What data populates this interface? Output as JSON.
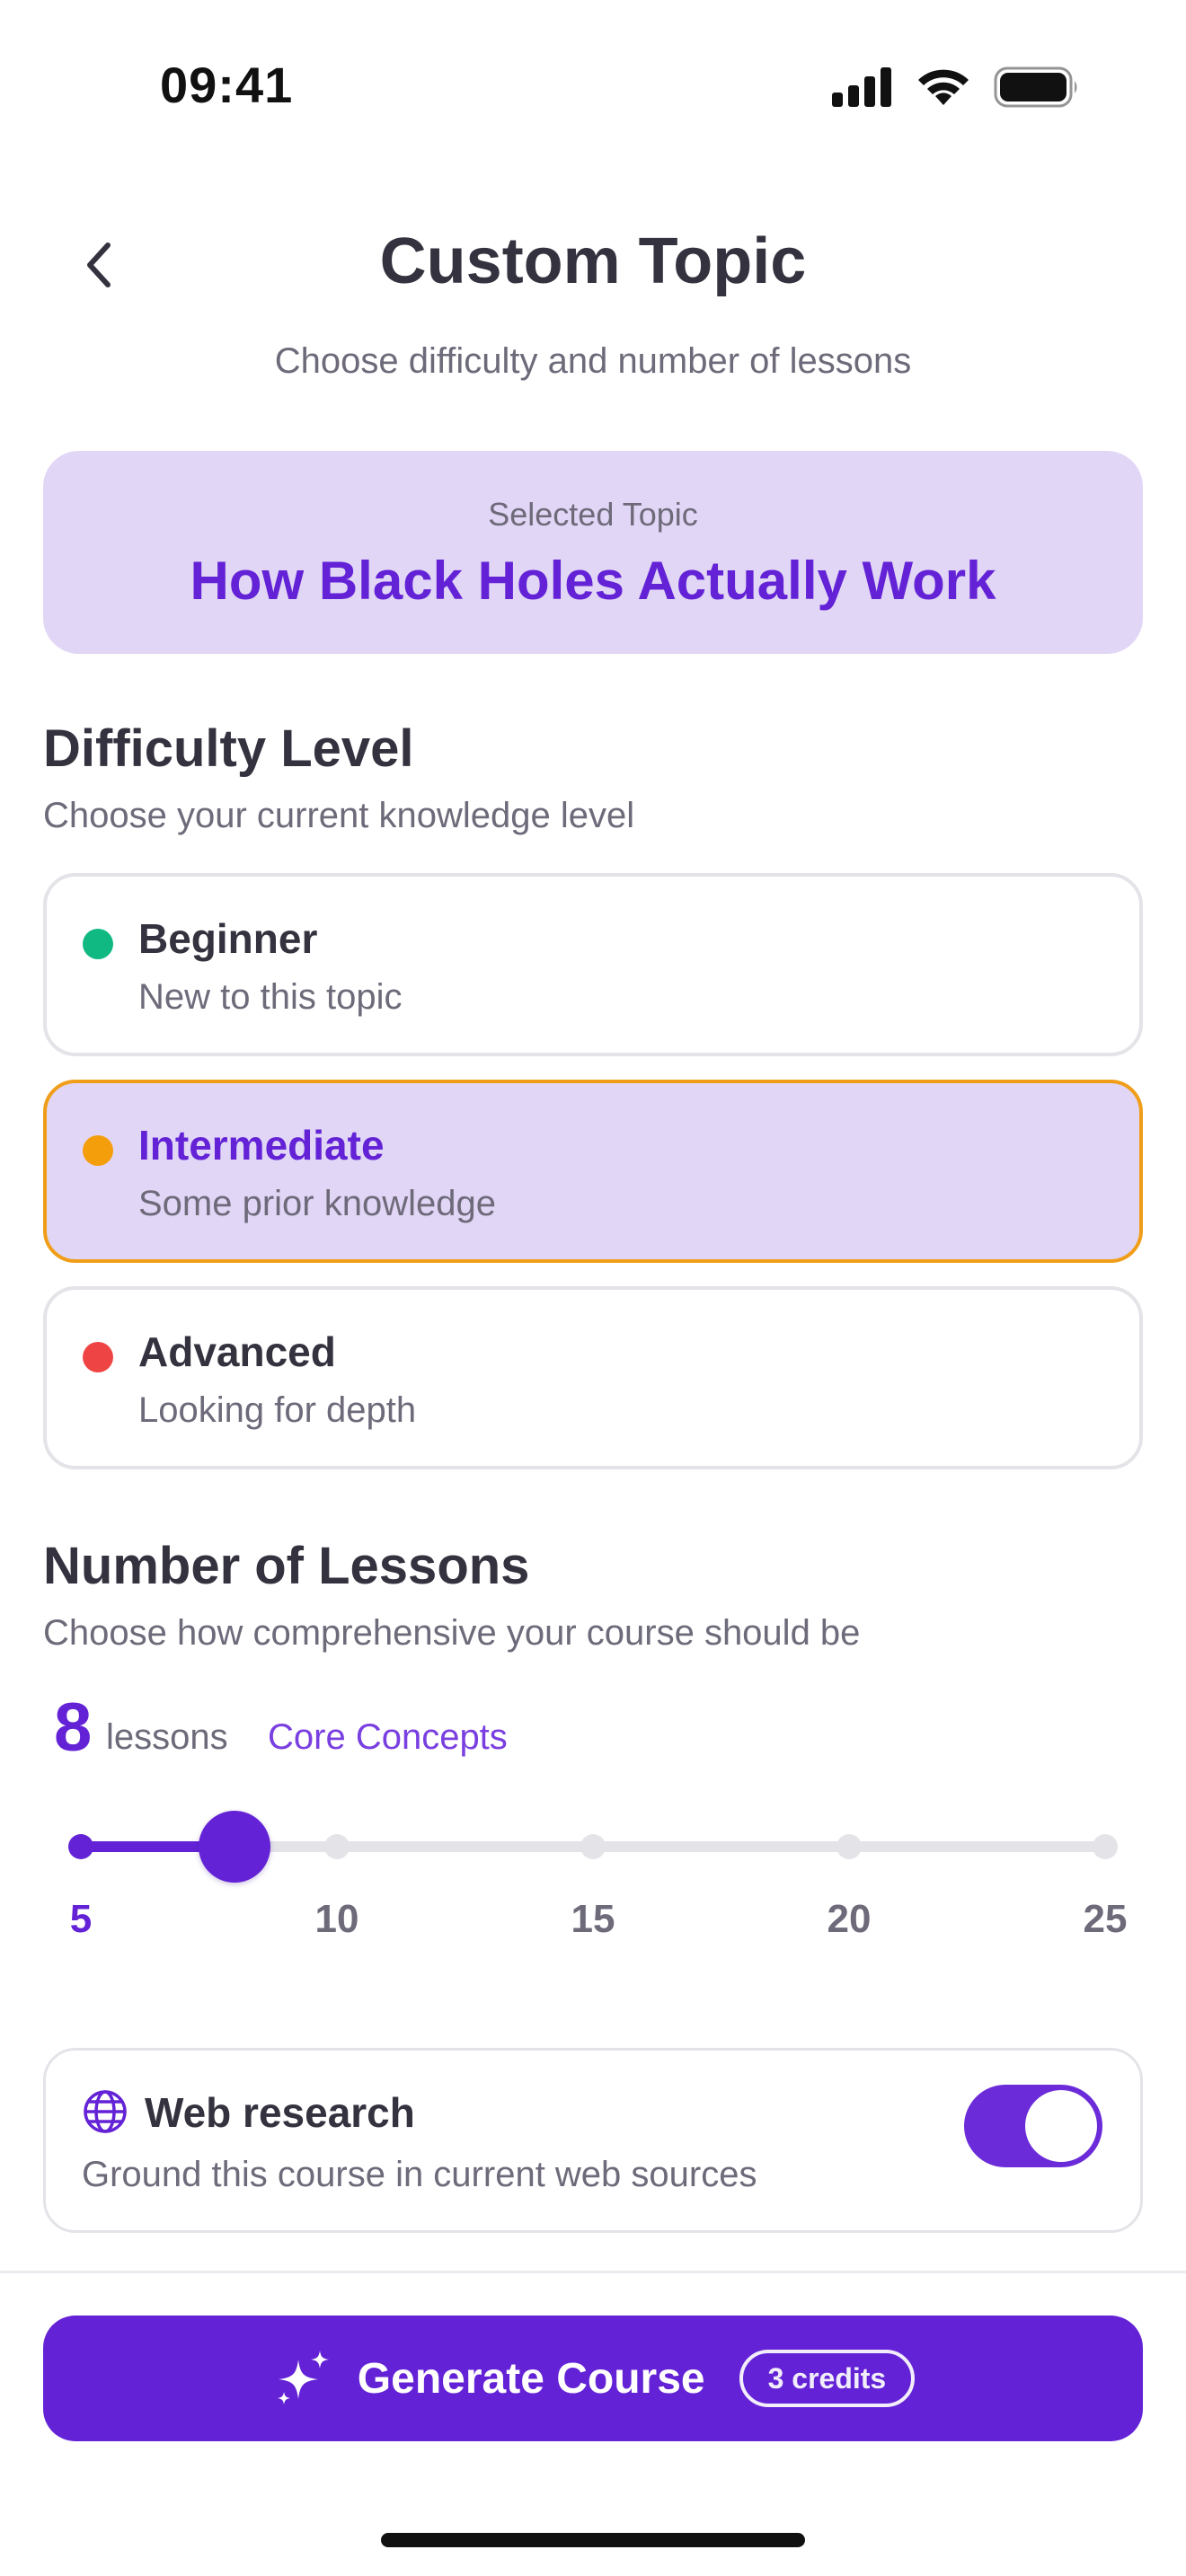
{
  "status_bar": {
    "time": "09:41"
  },
  "header": {
    "title": "Custom Topic",
    "subtitle": "Choose difficulty and number of lessons"
  },
  "topic": {
    "label": "Selected Topic",
    "name": "How Black Holes Actually Work"
  },
  "difficulty": {
    "title": "Difficulty Level",
    "description": "Choose your current knowledge level",
    "selected": "Intermediate",
    "options": [
      {
        "label": "Beginner",
        "description": "New to this topic",
        "color": "#10b981"
      },
      {
        "label": "Intermediate",
        "description": "Some prior knowledge",
        "color": "#f59e0b"
      },
      {
        "label": "Advanced",
        "description": "Looking for depth",
        "color": "#ef4444"
      }
    ]
  },
  "lessons": {
    "title": "Number of Lessons",
    "description": "Choose how comprehensive your course should be",
    "count": "8",
    "unit": "lessons",
    "tier": "Core Concepts",
    "value": 8,
    "min": 5,
    "max": 25,
    "ticks": [
      "5",
      "10",
      "15",
      "20",
      "25"
    ]
  },
  "web_research": {
    "title": "Web research",
    "description": "Ground this course in current web sources",
    "enabled": true
  },
  "generate": {
    "label": "Generate Course",
    "credits": "3 credits"
  },
  "colors": {
    "accent": "#6322d6",
    "selected_border": "#f09e1a",
    "selected_bg": "#e1d6f5"
  }
}
